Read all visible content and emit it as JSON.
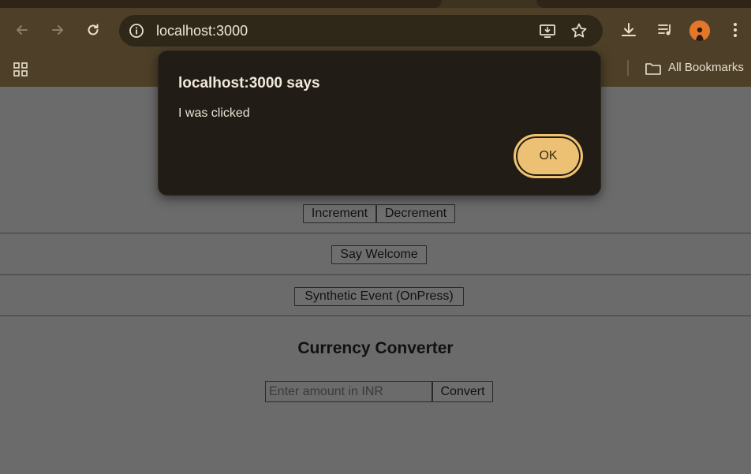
{
  "browser": {
    "url": "localhost:3000",
    "bookmarks_folder": "All Bookmarks"
  },
  "page": {
    "increment_label": "Increment",
    "decrement_label": "Decrement",
    "say_welcome_label": "Say Welcome",
    "synthetic_event_label": "Synthetic Event (OnPress)",
    "currency_heading": "Currency Converter",
    "amount_placeholder": "Enter amount in INR",
    "convert_label": "Convert"
  },
  "dialog": {
    "title": "localhost:3000 says",
    "message": "I was clicked",
    "ok_label": "OK"
  },
  "colors": {
    "chrome": "#4e4028",
    "omnibox": "#2f2718",
    "dialog_bg": "#211c15",
    "ok_button": "#edc174",
    "page_overlay": "#6b6b6b"
  }
}
